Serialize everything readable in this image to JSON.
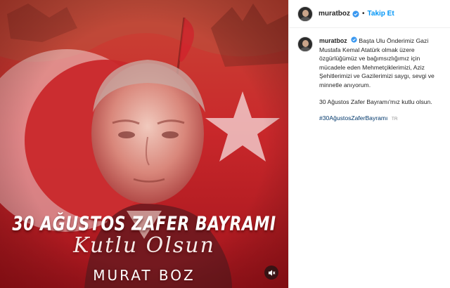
{
  "post": {
    "account": {
      "username": "muratboz",
      "verified": true,
      "follow_label": "Takip Et",
      "separator": "•"
    },
    "media": {
      "title_line": "30 AĞUSTOS ZAFER BAYRAMI",
      "script_line": "Kutlu Olsun",
      "signature": "MURAT BOZ",
      "reel_icon": "reel-icon"
    },
    "caption": {
      "first_text": "Başta Ulu Önderimiz Gazi Mustafa Kemal Atatürk olmak üzere özgürlüğümüz ve bağımsızlığımız için mücadele eden Mehmetçiklerimizi, Aziz Şehitlerimizi ve Gazilerimizi saygı, sevgi ve minnetle anıyorum.",
      "second_paragraph": "30 Ağustos Zafer Bayramı'mız kutlu olsun.",
      "hashtag": "#30AğustosZaferBayramı",
      "translate_label": "TR"
    },
    "colors": {
      "accent": "#0095f6",
      "verified_badge": "#3897f0",
      "hashtag": "#00376b",
      "flag_red": "#c8102e"
    }
  }
}
